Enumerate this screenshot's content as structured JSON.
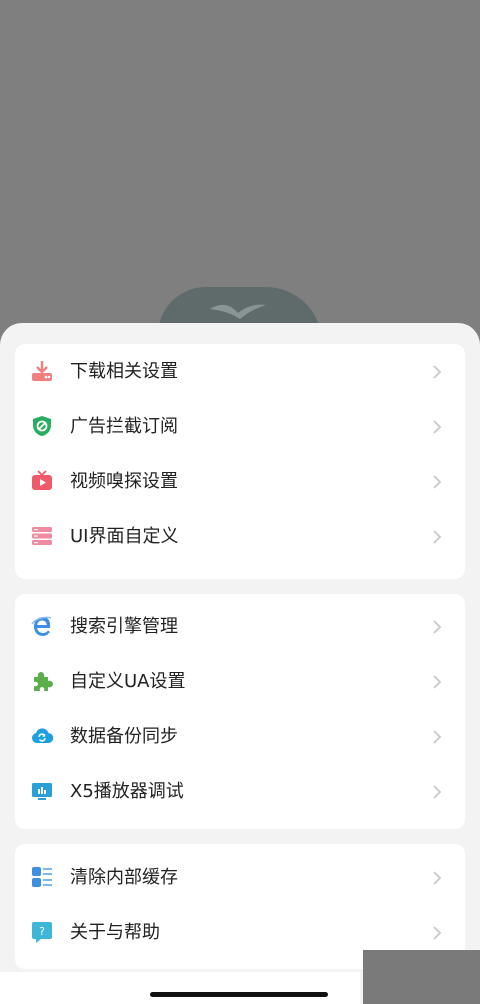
{
  "colors": {
    "overlay": "#7f7f7f",
    "sheet": "#f3f3f3",
    "card": "#ffffff",
    "text": "#222222",
    "chevron": "#c8c8c8"
  },
  "groups": [
    {
      "items": [
        {
          "label": "下载相关设置",
          "icon": "download-icon",
          "color": "#f07f7f"
        },
        {
          "label": "广告拦截订阅",
          "icon": "shield-block-icon",
          "color": "#27ae60"
        },
        {
          "label": "视频嗅探设置",
          "icon": "video-tv-icon",
          "color": "#ee5a6a"
        },
        {
          "label": "UI界面自定义",
          "icon": "ui-layout-icon",
          "color": "#f08aa0"
        }
      ]
    },
    {
      "items": [
        {
          "label": "搜索引擎管理",
          "icon": "search-engine-icon",
          "color": "#3f8fe0"
        },
        {
          "label": "自定义UA设置",
          "icon": "puzzle-icon",
          "color": "#5cae4a"
        },
        {
          "label": "数据备份同步",
          "icon": "cloud-sync-icon",
          "color": "#1ea0e0"
        },
        {
          "label": "X5播放器调试",
          "icon": "monitor-chart-icon",
          "color": "#2aa0d6"
        }
      ]
    },
    {
      "items": [
        {
          "label": "清除内部缓存",
          "icon": "list-clear-icon",
          "color": "#3f8fe0"
        },
        {
          "label": "关于与帮助",
          "icon": "help-bubble-icon",
          "color": "#3fb6d8"
        }
      ]
    }
  ]
}
